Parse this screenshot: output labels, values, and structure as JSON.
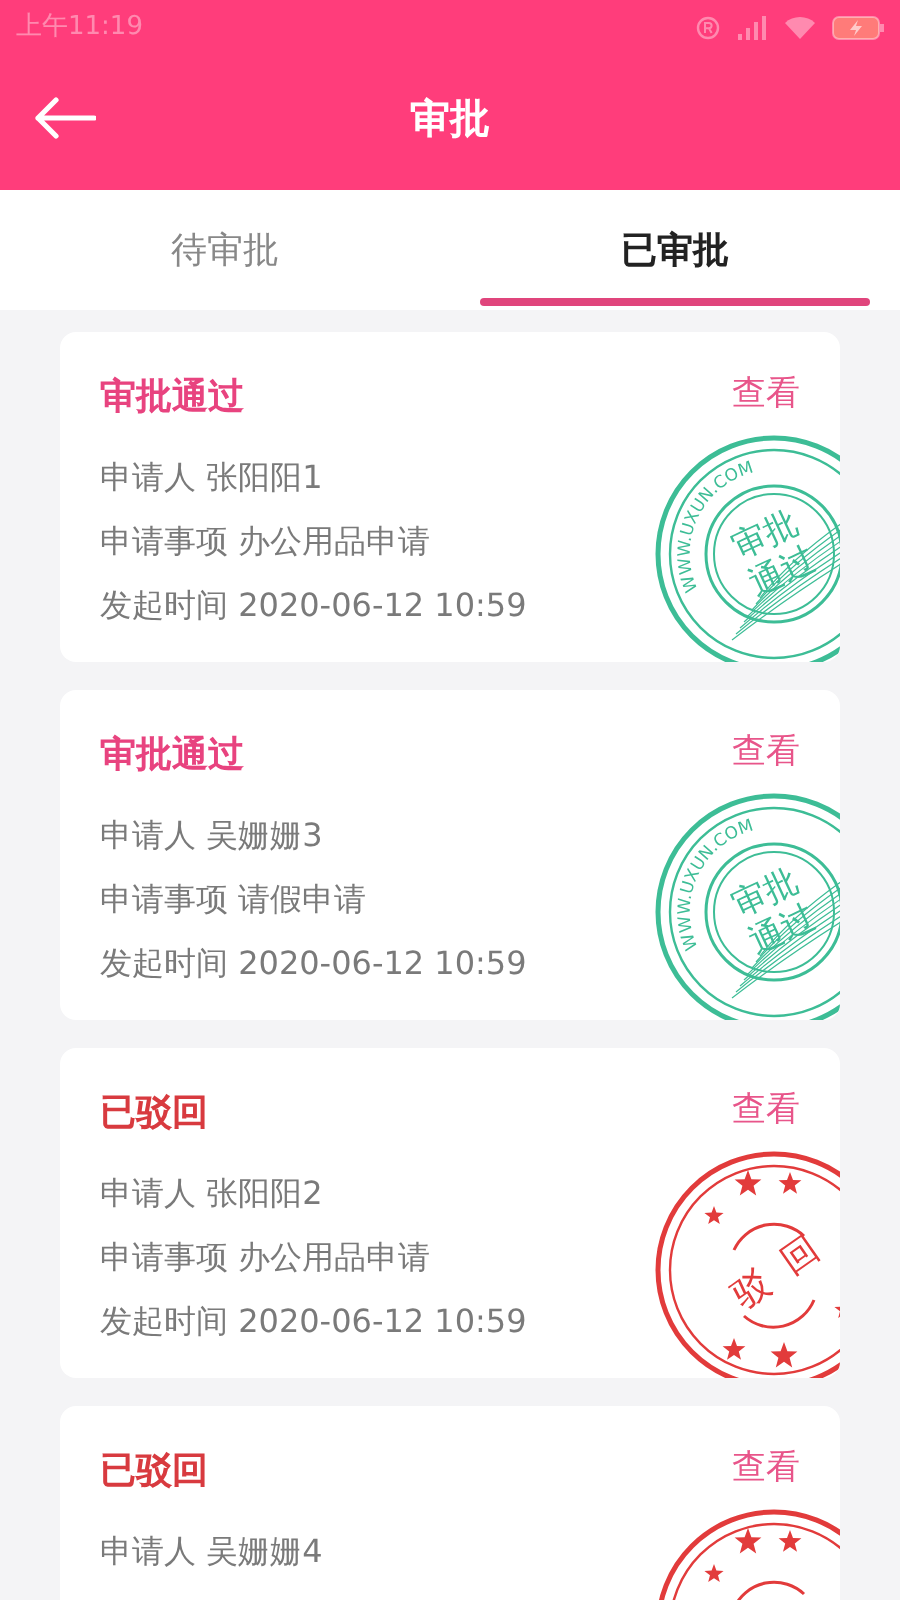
{
  "status_bar": {
    "time": "上午11:19"
  },
  "header": {
    "title": "审批"
  },
  "tabs": [
    {
      "label": "待审批",
      "selected": false
    },
    {
      "label": "已审批",
      "selected": true
    }
  ],
  "records": [
    {
      "status": "审批通过",
      "kind": "approved",
      "action": "查看",
      "lines": [
        "申请人 张阳阳1",
        "申请事项 办公用品申请",
        "发起时间 2020-06-12 10:59"
      ],
      "stamp": {
        "url": "WWW.UXUN.COM",
        "label": [
          "审批",
          "通过"
        ]
      }
    },
    {
      "status": "审批通过",
      "kind": "approved",
      "action": "查看",
      "lines": [
        "申请人 吴姗姗3",
        "申请事项 请假申请",
        "发起时间 2020-06-12 10:59"
      ],
      "stamp": {
        "url": "WWW.UXUN.COM",
        "label": [
          "审批",
          "通过"
        ]
      }
    },
    {
      "status": "已驳回",
      "kind": "rejected",
      "action": "查看",
      "lines": [
        "申请人 张阳阳2",
        "申请事项 办公用品申请",
        "发起时间 2020-06-12 10:59"
      ],
      "stamp": {
        "label": [
          "驳",
          "回"
        ]
      }
    },
    {
      "status": "已驳回",
      "kind": "rejected",
      "action": "查看",
      "lines": [
        "申请人 吴姗姗4"
      ]
    }
  ]
}
